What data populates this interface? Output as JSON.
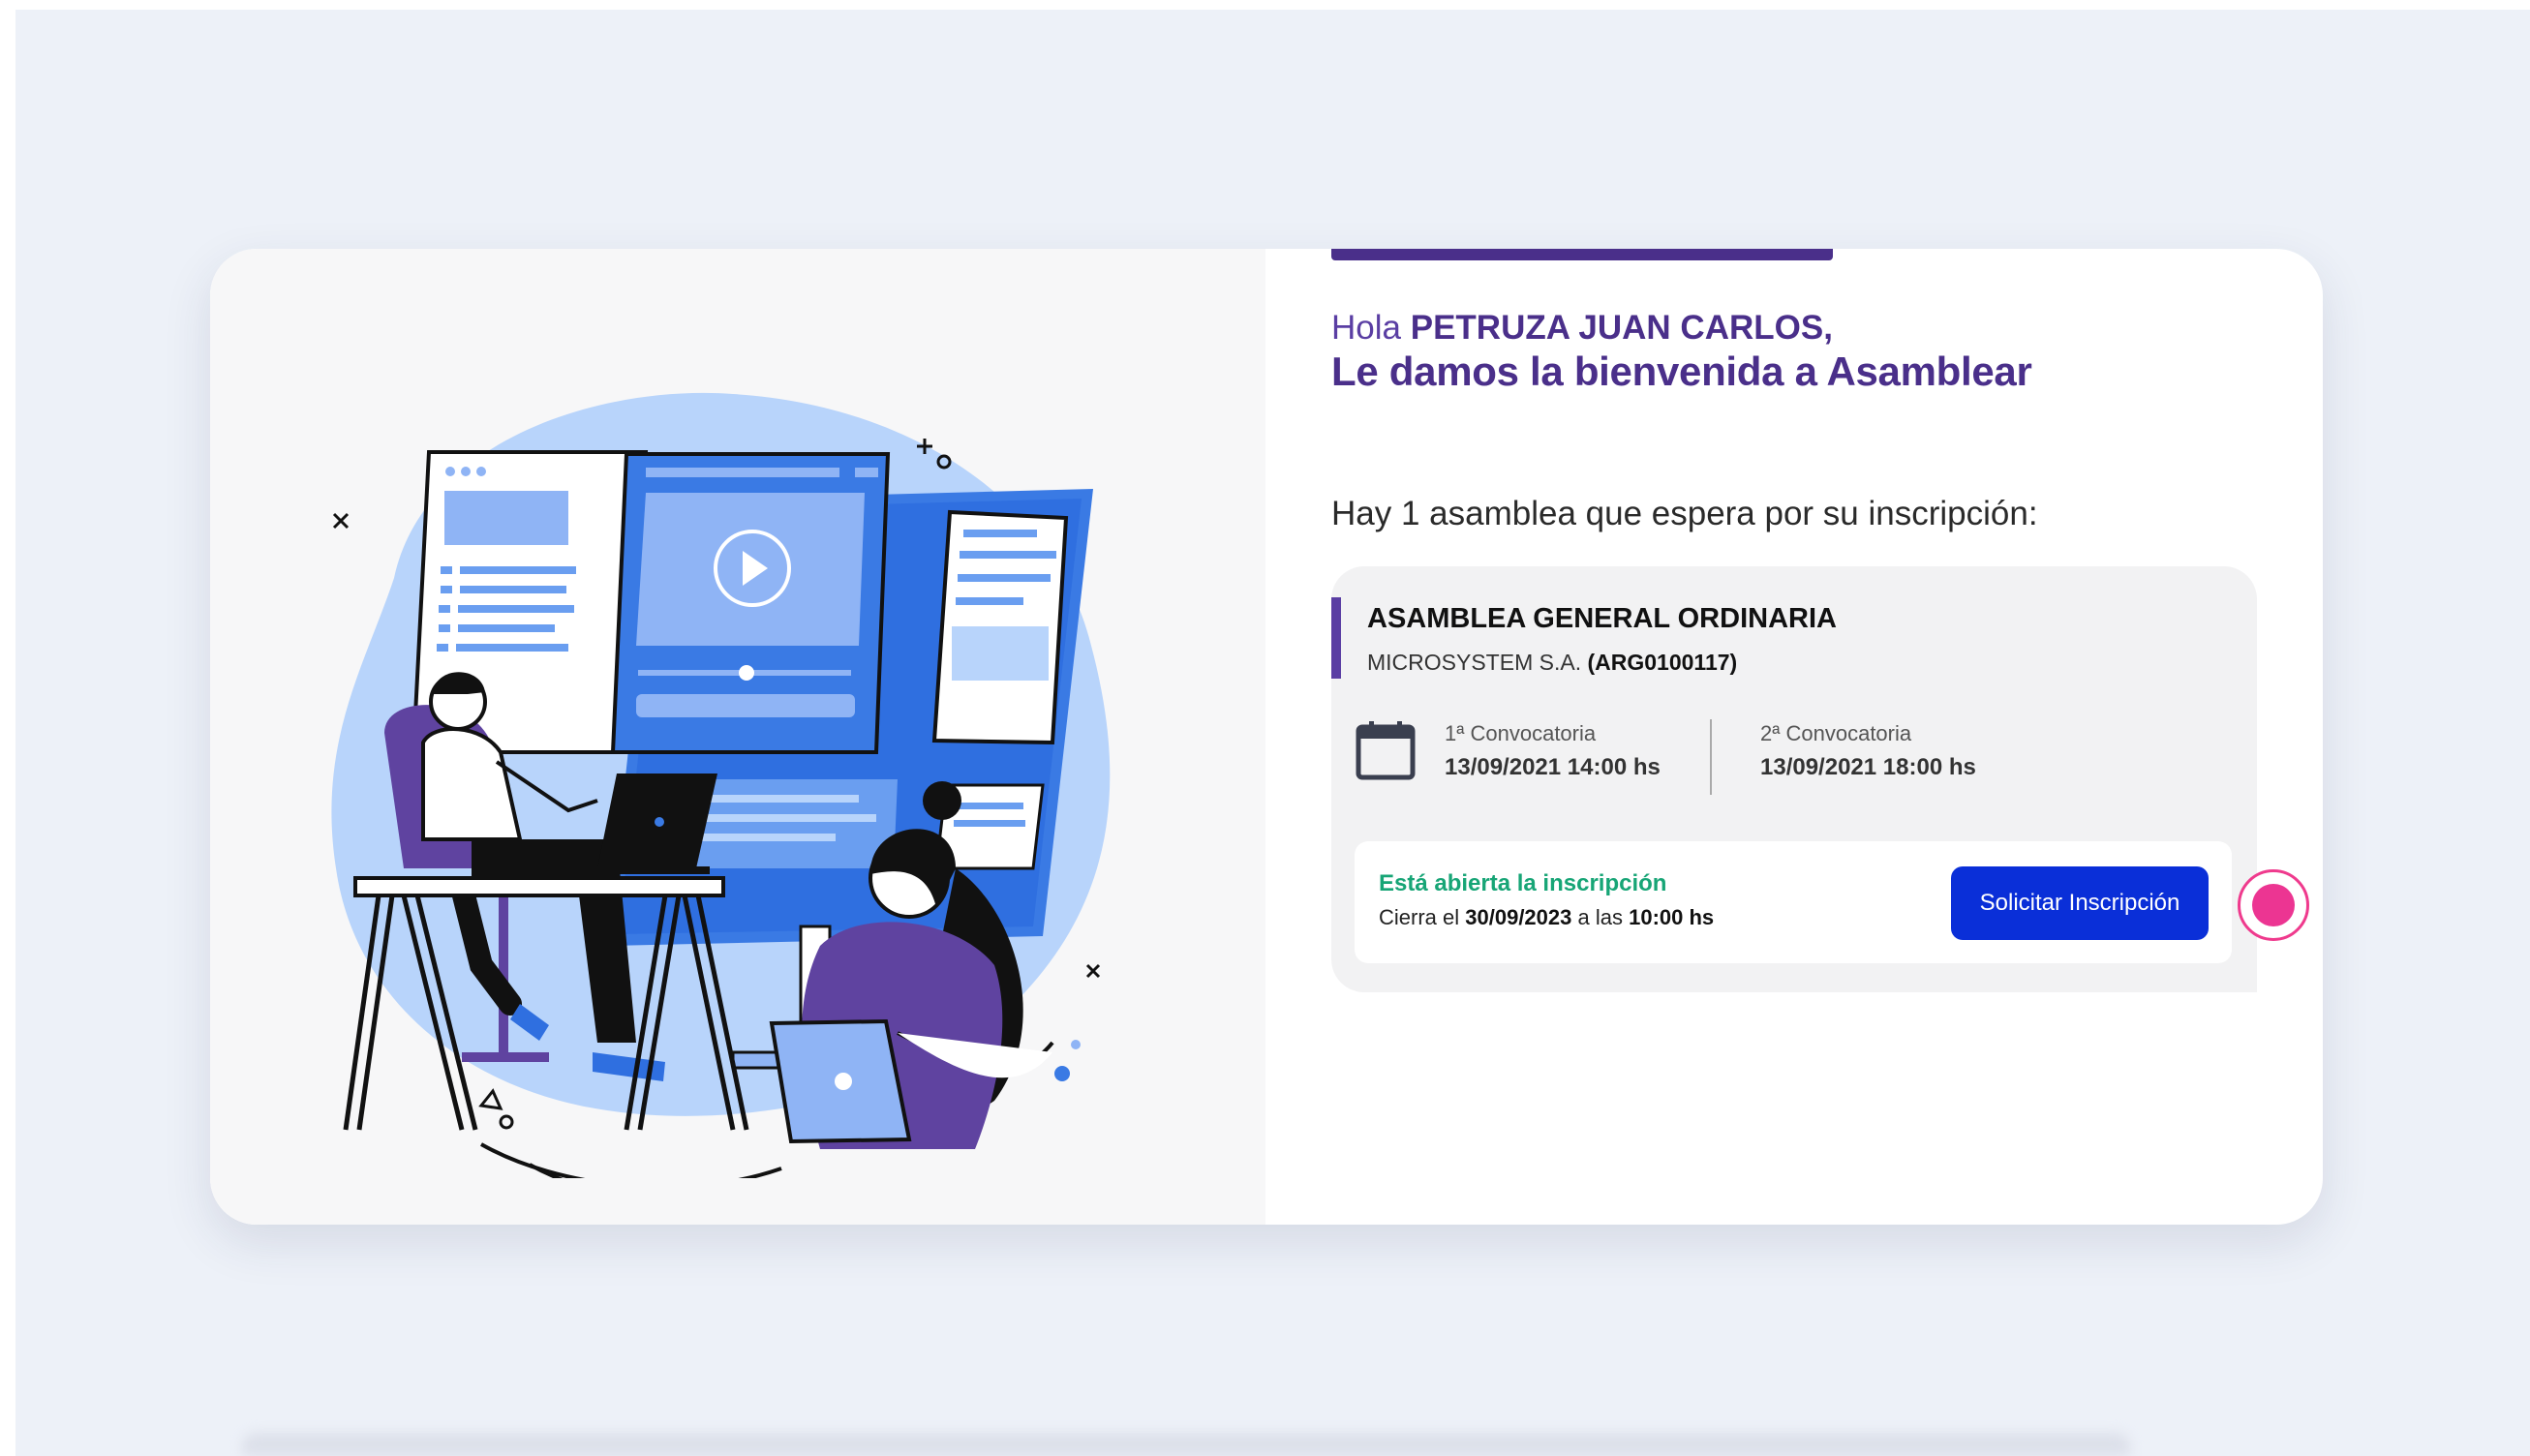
{
  "greeting": {
    "prefix": "Hola",
    "name": "PETRUZA JUAN CARLOS,",
    "welcome": "Le damos la bienvenida a Asamblear"
  },
  "notice": "Hay 1 asamblea que espera por su inscripción:",
  "assembly": {
    "title": "ASAMBLEA GENERAL ORDINARIA",
    "organization": "MICROSYSTEM S.A.",
    "code": "(ARG0100117)",
    "calendar_icon": "calendar-icon",
    "convocatorias": [
      {
        "label": "1ª Convocatoria",
        "datetime": "13/09/2021 14:00 hs"
      },
      {
        "label": "2ª Convocatoria",
        "datetime": "13/09/2021 18:00 hs"
      }
    ],
    "status": {
      "open_text": "Está abierta la inscripción",
      "close_prefix": "Cierra el",
      "close_date": "30/09/2023",
      "close_middle": "a las",
      "close_time": "10:00 hs"
    },
    "button_label": "Solicitar  Inscripción"
  },
  "colors": {
    "brand_purple": "#4a2f8a",
    "button_blue": "#0a2fd8",
    "status_green": "#17a576",
    "cursor_pink": "#ec3592"
  }
}
